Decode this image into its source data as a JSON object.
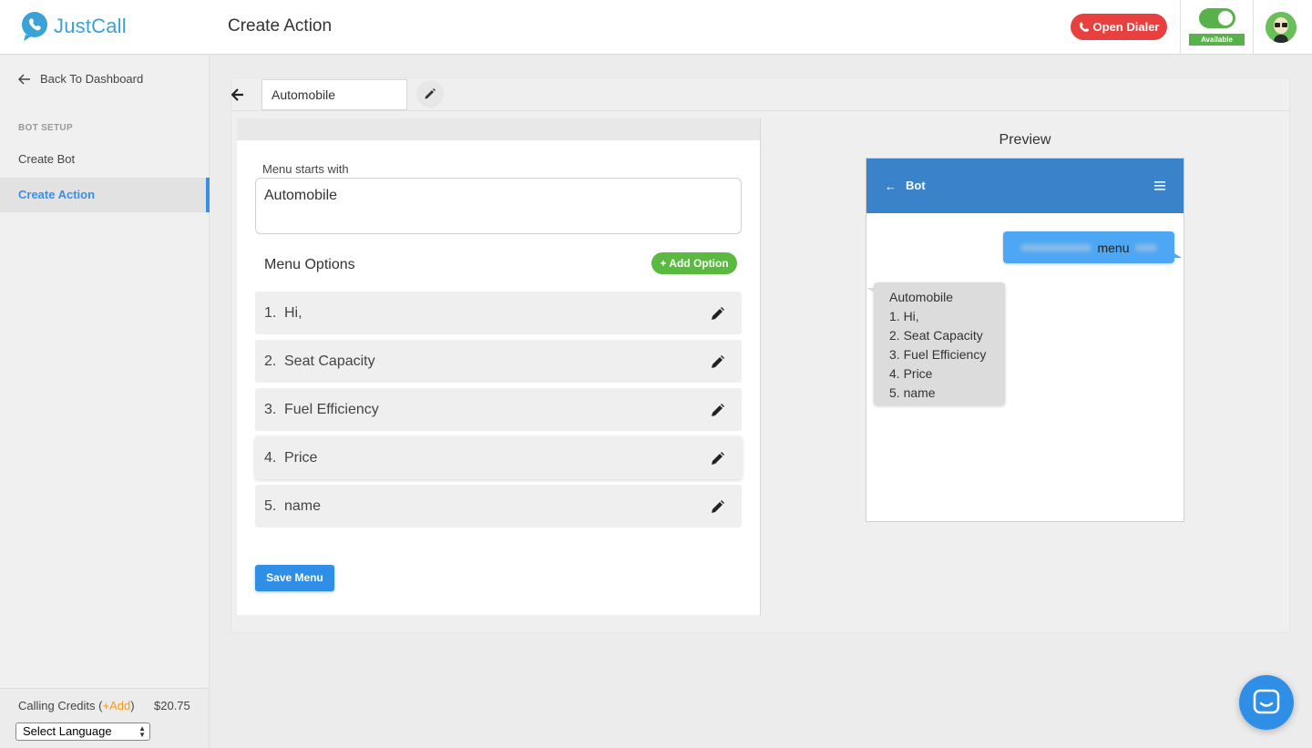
{
  "app": {
    "name": "JustCall"
  },
  "header": {
    "title": "Create Action",
    "open_dialer": "Open Dialer",
    "status": "Available"
  },
  "sidebar": {
    "back": "Back To Dashboard",
    "section": "BOT SETUP",
    "items": [
      {
        "label": "Create Bot",
        "active": false
      },
      {
        "label": "Create Action",
        "active": true
      }
    ],
    "credits": {
      "label_prefix": "Calling Credits (",
      "add": "+Add",
      "label_suffix": ")",
      "amount": "$20.75"
    },
    "language": "Select Language"
  },
  "action": {
    "name": "Automobile",
    "menu_starts_label": "Menu starts with",
    "menu_starts_value": "Automobile",
    "options_title": "Menu Options",
    "add_option": "+ Add Option",
    "options": [
      {
        "num": "1.",
        "label": "Hi,"
      },
      {
        "num": "2.",
        "label": "Seat Capacity"
      },
      {
        "num": "3.",
        "label": "Fuel Efficiency"
      },
      {
        "num": "4.",
        "label": "Price"
      },
      {
        "num": "5.",
        "label": "name"
      }
    ],
    "save": "Save Menu"
  },
  "preview": {
    "title": "Preview",
    "bot_name": "Bot",
    "user_message": "menu",
    "bot_lines": [
      "Automobile",
      "1. Hi,",
      "2. Seat Capacity",
      "3. Fuel Efficiency",
      "4. Price",
      "5. name"
    ]
  },
  "colors": {
    "accent": "#2f8fe6",
    "danger": "#e8403f",
    "success": "#5ab93f",
    "header_bot": "#3a83cb"
  }
}
